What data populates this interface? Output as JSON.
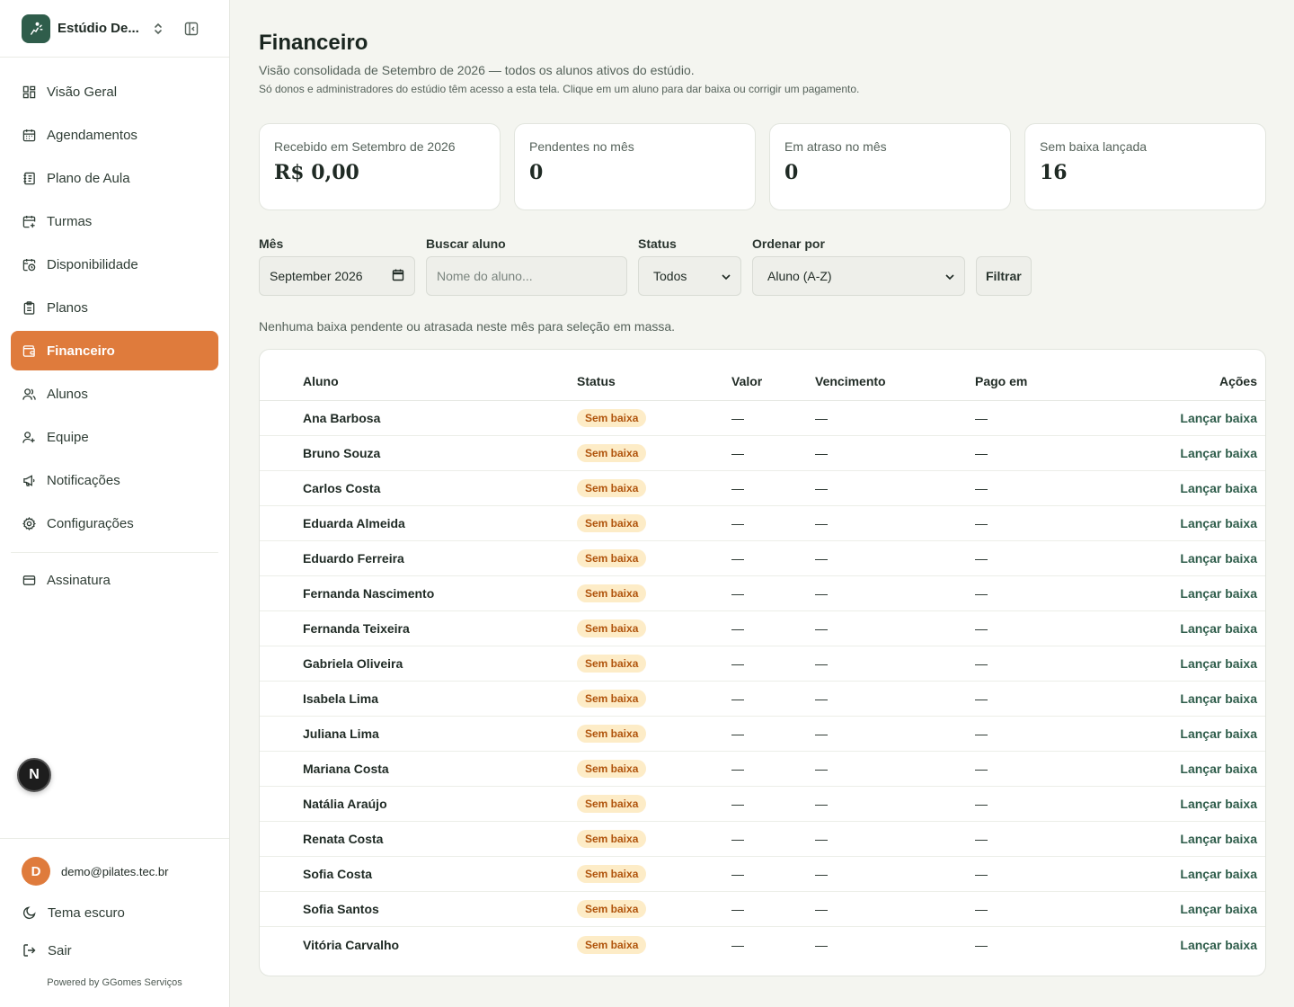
{
  "sidebar": {
    "studio_name": "Estúdio De...",
    "nav": [
      {
        "label": "Visão Geral",
        "icon": "dashboard-icon"
      },
      {
        "label": "Agendamentos",
        "icon": "calendar-icon"
      },
      {
        "label": "Plano de Aula",
        "icon": "notebook-icon"
      },
      {
        "label": "Turmas",
        "icon": "calendar-plus-icon"
      },
      {
        "label": "Disponibilidade",
        "icon": "calendar-clock-icon"
      },
      {
        "label": "Planos",
        "icon": "clipboard-icon"
      },
      {
        "label": "Financeiro",
        "icon": "wallet-icon",
        "active": true
      },
      {
        "label": "Alunos",
        "icon": "users-icon"
      },
      {
        "label": "Equipe",
        "icon": "user-team-icon"
      },
      {
        "label": "Notificações",
        "icon": "megaphone-icon"
      },
      {
        "label": "Configurações",
        "icon": "gear-icon"
      }
    ],
    "subscription": {
      "label": "Assinatura",
      "icon": "credit-card-icon"
    },
    "next_badge": "N",
    "user": {
      "initial": "D",
      "email": "demo@pilates.tec.br"
    },
    "theme_label": "Tema escuro",
    "logout_label": "Sair",
    "powered_by": "Powered by GGomes Serviços"
  },
  "header": {
    "title": "Financeiro",
    "subtitle": "Visão consolidada de Setembro de 2026 — todos os alunos ativos do estúdio.",
    "note": "Só donos e administradores do estúdio têm acesso a esta tela. Clique em um aluno para dar baixa ou corrigir um pagamento."
  },
  "cards": [
    {
      "label": "Recebido em Setembro de 2026",
      "value": "R$ 0,00"
    },
    {
      "label": "Pendentes no mês",
      "value": "0"
    },
    {
      "label": "Em atraso no mês",
      "value": "0"
    },
    {
      "label": "Sem baixa lançada",
      "value": "16"
    }
  ],
  "filters": {
    "month_label": "Mês",
    "month_value": "September  2026",
    "search_label": "Buscar aluno",
    "search_placeholder": "Nome do aluno...",
    "status_label": "Status",
    "status_value": "Todos",
    "sort_label": "Ordenar por",
    "sort_value": "Aluno (A-Z)",
    "filter_button": "Filtrar"
  },
  "bulk_message": "Nenhuma baixa pendente ou atrasada neste mês para seleção em massa.",
  "table": {
    "columns": [
      "Aluno",
      "Status",
      "Valor",
      "Vencimento",
      "Pago em",
      "Ações"
    ],
    "rows": [
      {
        "name": "Ana Barbosa",
        "status": "Sem baixa",
        "valor": "—",
        "vencimento": "—",
        "pago": "—",
        "action": "Lançar baixa"
      },
      {
        "name": "Bruno Souza",
        "status": "Sem baixa",
        "valor": "—",
        "vencimento": "—",
        "pago": "—",
        "action": "Lançar baixa"
      },
      {
        "name": "Carlos Costa",
        "status": "Sem baixa",
        "valor": "—",
        "vencimento": "—",
        "pago": "—",
        "action": "Lançar baixa"
      },
      {
        "name": "Eduarda Almeida",
        "status": "Sem baixa",
        "valor": "—",
        "vencimento": "—",
        "pago": "—",
        "action": "Lançar baixa"
      },
      {
        "name": "Eduardo Ferreira",
        "status": "Sem baixa",
        "valor": "—",
        "vencimento": "—",
        "pago": "—",
        "action": "Lançar baixa"
      },
      {
        "name": "Fernanda Nascimento",
        "status": "Sem baixa",
        "valor": "—",
        "vencimento": "—",
        "pago": "—",
        "action": "Lançar baixa"
      },
      {
        "name": "Fernanda Teixeira",
        "status": "Sem baixa",
        "valor": "—",
        "vencimento": "—",
        "pago": "—",
        "action": "Lançar baixa"
      },
      {
        "name": "Gabriela Oliveira",
        "status": "Sem baixa",
        "valor": "—",
        "vencimento": "—",
        "pago": "—",
        "action": "Lançar baixa"
      },
      {
        "name": "Isabela Lima",
        "status": "Sem baixa",
        "valor": "—",
        "vencimento": "—",
        "pago": "—",
        "action": "Lançar baixa"
      },
      {
        "name": "Juliana Lima",
        "status": "Sem baixa",
        "valor": "—",
        "vencimento": "—",
        "pago": "—",
        "action": "Lançar baixa"
      },
      {
        "name": "Mariana Costa",
        "status": "Sem baixa",
        "valor": "—",
        "vencimento": "—",
        "pago": "—",
        "action": "Lançar baixa"
      },
      {
        "name": "Natália Araújo",
        "status": "Sem baixa",
        "valor": "—",
        "vencimento": "—",
        "pago": "—",
        "action": "Lançar baixa"
      },
      {
        "name": "Renata Costa",
        "status": "Sem baixa",
        "valor": "—",
        "vencimento": "—",
        "pago": "—",
        "action": "Lançar baixa"
      },
      {
        "name": "Sofia Costa",
        "status": "Sem baixa",
        "valor": "—",
        "vencimento": "—",
        "pago": "—",
        "action": "Lançar baixa"
      },
      {
        "name": "Sofia Santos",
        "status": "Sem baixa",
        "valor": "—",
        "vencimento": "—",
        "pago": "—",
        "action": "Lançar baixa"
      },
      {
        "name": "Vitória Carvalho",
        "status": "Sem baixa",
        "valor": "—",
        "vencimento": "—",
        "pago": "—",
        "action": "Lançar baixa"
      }
    ]
  },
  "colors": {
    "brand": "#2f5d4b",
    "accent": "#df7b3c",
    "badge_bg": "#fdecc7",
    "badge_text": "#b0540c",
    "background": "#f4f5f0"
  }
}
